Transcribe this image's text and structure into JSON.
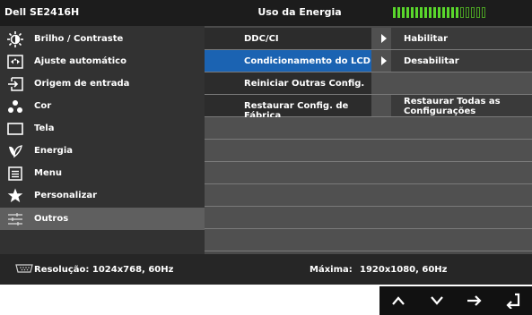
{
  "title_bar": {
    "model": "Dell SE2416H",
    "title": "Uso da Energia",
    "energy_level": 0.75
  },
  "menu": [
    {
      "label": "Brilho / Contraste",
      "icon": "brightness-icon"
    },
    {
      "label": "Ajuste automático",
      "icon": "auto-adjust-icon"
    },
    {
      "label": "Origem de entrada",
      "icon": "input-source-icon"
    },
    {
      "label": "Cor",
      "icon": "color-icon"
    },
    {
      "label": "Tela",
      "icon": "display-icon"
    },
    {
      "label": "Energia",
      "icon": "energy-icon"
    },
    {
      "label": "Menu",
      "icon": "menu-icon"
    },
    {
      "label": "Personalizar",
      "icon": "star-icon"
    },
    {
      "label": "Outros",
      "icon": "others-icon"
    }
  ],
  "selected_menu": "Outros",
  "submenu": [
    {
      "label": "DDC/CI",
      "value": "Habilitar",
      "has_arrow": true
    },
    {
      "label": "Condicionamento do LCD",
      "value": "Desabilitar",
      "has_arrow": true,
      "selected": true
    },
    {
      "label": "Reiniciar Outras Config.",
      "value": ""
    },
    {
      "label": "Restaurar Config. de Fábrica",
      "value": "Restaurar Todas as Configurações"
    }
  ],
  "status": {
    "resolution_label": "Resolução: 1024x768, 60Hz",
    "max_label": "Máxima:",
    "max_value": "1920x1080, 60Hz"
  },
  "nav_buttons": [
    "up-arrow-icon",
    "down-arrow-icon",
    "right-arrow-icon",
    "back-arrow-icon"
  ],
  "colors": {
    "selected_blue": "#1b63b2",
    "energy_green": "#5ad72c"
  }
}
